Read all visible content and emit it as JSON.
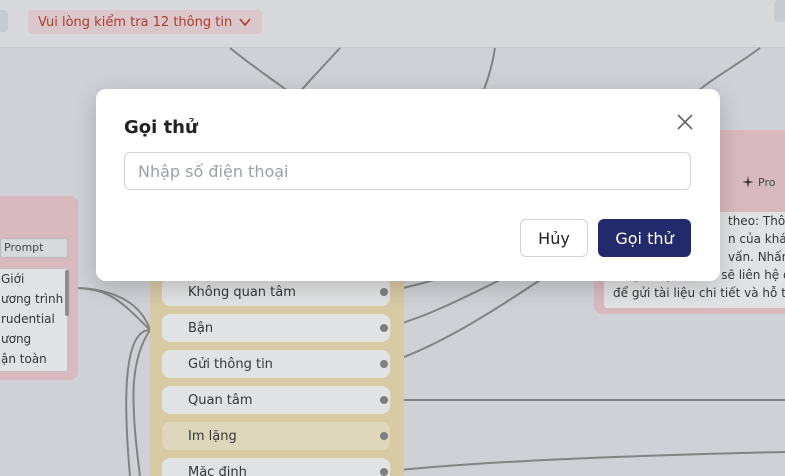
{
  "header": {
    "warning_label": "Vui lòng kiểm tra 12 thông tin",
    "warning_icon": "chevron-down-icon"
  },
  "left_node": {
    "prompt_label": "Prompt",
    "lines": [
      "Giới",
      "ương trình",
      "rudential",
      "ương",
      "ận toàn"
    ]
  },
  "options_node": {
    "items": [
      "Không quan tâm",
      "Bận",
      "Gửi thông tin",
      "Quan tâm",
      "Im lặng",
      "Mặc định"
    ]
  },
  "right_node": {
    "prompt_label": "Pro",
    "lines": [
      "theo: Thôn",
      "n của khách",
      "vấn. Nhấn n",
      "rằng chuyên viên sẽ liên hệ qua",
      "để gửi tài liệu chi tiết và hỗ trợ"
    ]
  },
  "dialog": {
    "title": "Gọi thử",
    "phone_placeholder": "Nhập số điện thoại",
    "phone_value": "",
    "cancel_label": "Hủy",
    "call_label": "Gọi thử",
    "close_icon": "close-icon"
  },
  "colors": {
    "primary": "#232a6b",
    "warning_bg": "#f7dfe3",
    "warning_text": "#c0392b",
    "node_pink": "#f6cfd6",
    "node_yellow": "#f3e3b5"
  }
}
